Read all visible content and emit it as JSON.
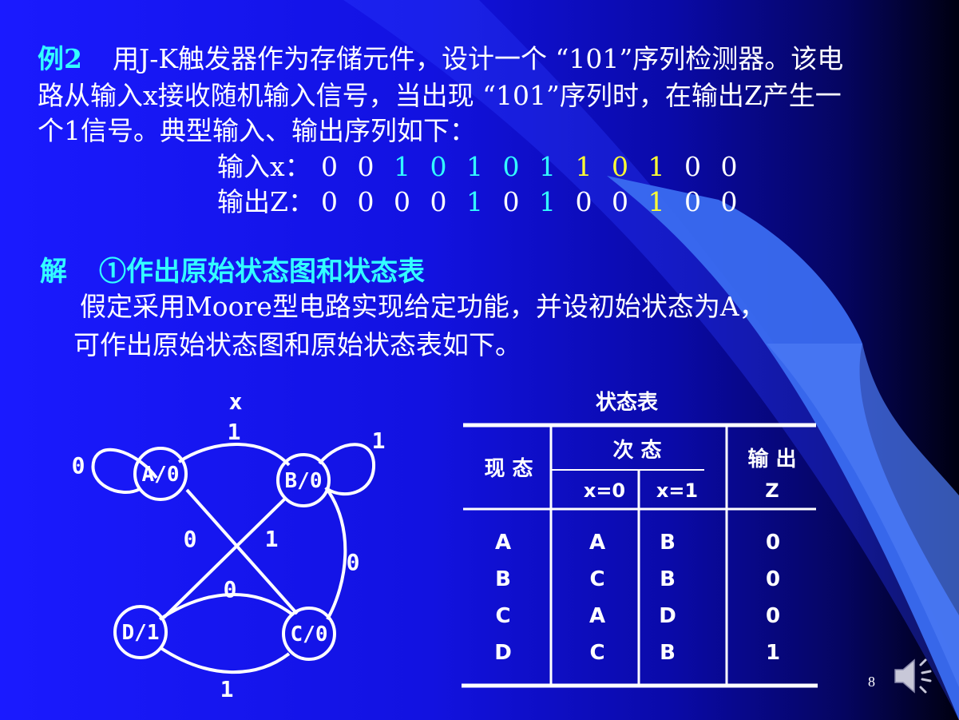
{
  "problem": {
    "label": "例2",
    "line1": "用J-K触发器作为存储元件，设计一个 “101”序列检测器。该电",
    "line2": "路从输入x接收随机输入信号，当出现 “101”序列时，在输出Z产生一",
    "line3": "个1信号。典型输入、输出序列如下："
  },
  "sequences": {
    "input_label": "输入x：",
    "input_digits": [
      "0",
      "0",
      "1",
      "0",
      "1",
      "0",
      "1",
      "1",
      "0",
      "1",
      "0",
      "0"
    ],
    "input_colors": [
      "white",
      "white",
      "cyan",
      "cyan",
      "cyan",
      "cyan",
      "cyan",
      "yellow",
      "yellow",
      "yellow",
      "white",
      "white"
    ],
    "output_label": "输出Z：",
    "output_digits": [
      "0",
      "0",
      "0",
      "0",
      "1",
      "0",
      "1",
      "0",
      "0",
      "1",
      "0",
      "0"
    ],
    "output_colors": [
      "white",
      "white",
      "white",
      "white",
      "cyan",
      "white",
      "cyan",
      "white",
      "white",
      "yellow",
      "white",
      "white"
    ]
  },
  "solution": {
    "label": "解",
    "heading": "①作出原始状态图和状态表",
    "line1": "假定采用Moore型电路实现给定功能，并设初始状态为A，",
    "line2": "可作出原始状态图和原始状态表如下。"
  },
  "state_diagram": {
    "input_var": "x",
    "states": [
      {
        "id": "A",
        "label": "A/0"
      },
      {
        "id": "B",
        "label": "B/0"
      },
      {
        "id": "C",
        "label": "C/0"
      },
      {
        "id": "D",
        "label": "D/1"
      }
    ],
    "transitions": [
      {
        "from": "A",
        "to": "A",
        "label": "0"
      },
      {
        "from": "A",
        "to": "B",
        "label": "1"
      },
      {
        "from": "B",
        "to": "B",
        "label": "1"
      },
      {
        "from": "B",
        "to": "C",
        "label": "0"
      },
      {
        "from": "C",
        "to": "A",
        "label": "0"
      },
      {
        "from": "C",
        "to": "D",
        "label": "1"
      },
      {
        "from": "D",
        "to": "C",
        "label": "0"
      },
      {
        "from": "D",
        "to": "B",
        "label": "1"
      }
    ]
  },
  "state_table": {
    "title": "状态表",
    "col_present": "现 态",
    "col_next": "次  态",
    "col_x0": "x=0",
    "col_x1": "x=1",
    "col_output": "输 出",
    "col_output_sub": "Z",
    "rows": [
      {
        "present": "A",
        "x0": "A",
        "x1": "B",
        "z": "0"
      },
      {
        "present": "B",
        "x0": "C",
        "x1": "B",
        "z": "0"
      },
      {
        "present": "C",
        "x0": "A",
        "x1": "D",
        "z": "0"
      },
      {
        "present": "D",
        "x0": "C",
        "x1": "B",
        "z": "1"
      }
    ]
  },
  "page_number": "8",
  "icons": {
    "speaker": "speaker-icon"
  },
  "colors": {
    "accent_cyan": "#33ffff",
    "accent_yellow": "#ffff33",
    "background_blue": "#1414e6",
    "sweep_blue": "#3a6cf0"
  }
}
